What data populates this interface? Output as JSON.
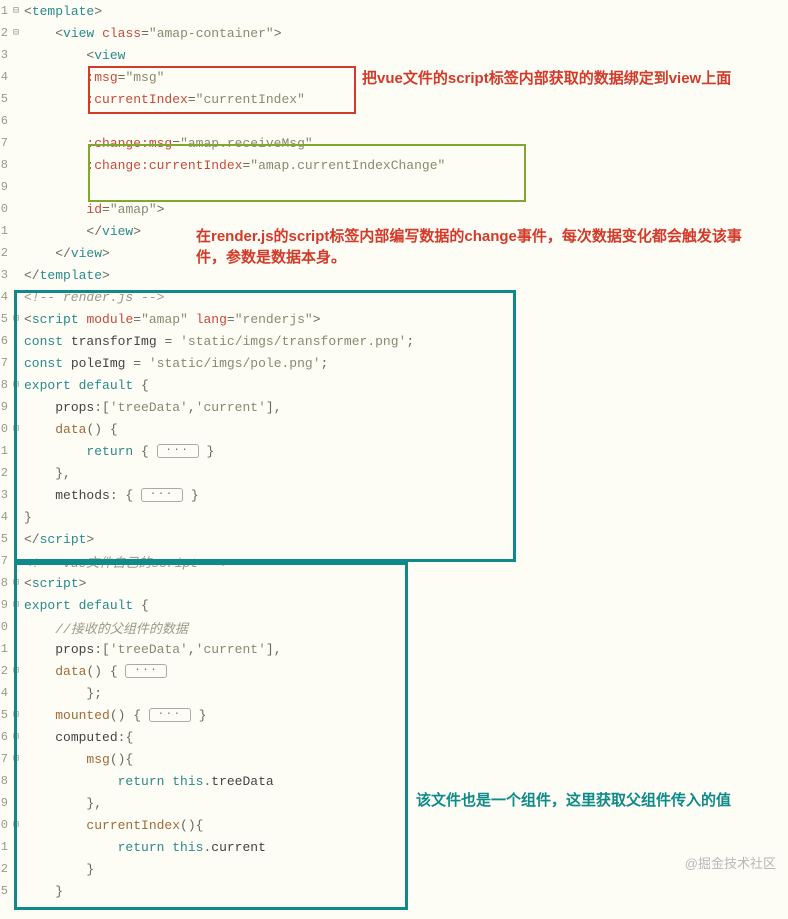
{
  "lines": [
    {
      "n": "1",
      "fold": "⊟",
      "html": "<span class='punct'>&lt;</span><span class='tag'>template</span><span class='punct'>&gt;</span>"
    },
    {
      "n": "2",
      "fold": "⊟",
      "html": "    <span class='punct'>&lt;</span><span class='tag'>view</span> <span class='attr'>class</span><span class='punct'>=</span><span class='str'>\"amap-container\"</span><span class='punct'>&gt;</span>"
    },
    {
      "n": "3",
      "fold": "",
      "html": "        <span class='punct'>&lt;</span><span class='tag'>view</span>"
    },
    {
      "n": "4",
      "fold": "",
      "html": "        <span class='attr'>:msg</span><span class='punct'>=</span><span class='str'>\"msg\"</span>"
    },
    {
      "n": "5",
      "fold": "",
      "html": "        <span class='attr'>:currentIndex</span><span class='punct'>=</span><span class='str'>\"currentIndex\"</span>"
    },
    {
      "n": "6",
      "fold": "",
      "html": ""
    },
    {
      "n": "7",
      "fold": "",
      "html": "        <span class='attr'>:change:msg</span><span class='punct'>=</span><span class='str'>\"amap.receiveMsg\"</span>"
    },
    {
      "n": "8",
      "fold": "",
      "html": "        <span class='attr'>:change:currentIndex</span><span class='punct'>=</span><span class='str'>\"amap.currentIndexChange\"</span>"
    },
    {
      "n": "9",
      "fold": "",
      "html": ""
    },
    {
      "n": "0",
      "fold": "",
      "html": "        <span class='attr'>id</span><span class='punct'>=</span><span class='str'>\"amap\"</span><span class='punct'>&gt;</span>"
    },
    {
      "n": "1",
      "fold": "",
      "html": "        <span class='punct'>&lt;/</span><span class='tag'>view</span><span class='punct'>&gt;</span>"
    },
    {
      "n": "2",
      "fold": "",
      "html": "    <span class='punct'>&lt;/</span><span class='tag'>view</span><span class='punct'>&gt;</span>"
    },
    {
      "n": "3",
      "fold": "",
      "html": "<span class='punct'>&lt;/</span><span class='tag'>template</span><span class='punct'>&gt;</span>"
    },
    {
      "n": "4",
      "fold": "",
      "html": "<span class='comment'>&lt;!-- render.js --&gt;</span>"
    },
    {
      "n": "5",
      "fold": "⊟",
      "html": "<span class='punct'>&lt;</span><span class='tag'>script</span> <span class='attr'>module</span><span class='punct'>=</span><span class='str'>\"amap\"</span> <span class='attr'>lang</span><span class='punct'>=</span><span class='str'>\"renderjs\"</span><span class='punct'>&gt;</span>"
    },
    {
      "n": "6",
      "fold": "",
      "html": "<span class='kw'>const</span> <span class='ident'>transforImg</span> <span class='punct'>=</span> <span class='str'>'static/imgs/transformer.png'</span><span class='punct'>;</span>"
    },
    {
      "n": "7",
      "fold": "",
      "html": "<span class='kw'>const</span> <span class='ident'>poleImg</span> <span class='punct'>=</span> <span class='str'>'static/imgs/pole.png'</span><span class='punct'>;</span>"
    },
    {
      "n": "8",
      "fold": "⊟",
      "html": "<span class='kw'>export</span> <span class='kw'>default</span> <span class='punct'>{</span>"
    },
    {
      "n": "9",
      "fold": "",
      "html": "    <span class='ident'>props</span><span class='punct'>:[</span><span class='str'>'treeData'</span><span class='punct'>,</span><span class='str'>'current'</span><span class='punct'>],</span>"
    },
    {
      "n": "0",
      "fold": "⊟",
      "html": "    <span class='kw2'>data</span><span class='punct'>() {</span>"
    },
    {
      "n": "1",
      "fold": "",
      "html": "        <span class='kw'>return</span> <span class='punct'>{</span> <span class='foldbox'>···</span> <span class='punct'>}</span>"
    },
    {
      "n": "2",
      "fold": "",
      "html": "    <span class='punct'>},</span>"
    },
    {
      "n": "3",
      "fold": "",
      "html": "    <span class='ident'>methods</span><span class='punct'>: {</span> <span class='foldbox'>···</span> <span class='punct'>}</span>"
    },
    {
      "n": "4",
      "fold": "",
      "html": "<span class='punct'>}</span>"
    },
    {
      "n": "5",
      "fold": "",
      "html": "<span class='punct'>&lt;/</span><span class='tag'>script</span><span class='punct'>&gt;</span>"
    },
    {
      "n": "7",
      "fold": "",
      "html": "<span class='comment'>&lt;!-- vue文件自己的script --&gt;</span>"
    },
    {
      "n": "8",
      "fold": "⊟",
      "html": "<span class='punct'>&lt;</span><span class='tag'>script</span><span class='punct'>&gt;</span>"
    },
    {
      "n": "9",
      "fold": "⊟",
      "html": "<span class='kw'>export</span> <span class='kw'>default</span> <span class='punct'>{</span>"
    },
    {
      "n": "0",
      "fold": "",
      "html": "    <span class='comment'>//接收的父组件的数据</span>"
    },
    {
      "n": "1",
      "fold": "",
      "html": "    <span class='ident'>props</span><span class='punct'>:[</span><span class='str'>'treeData'</span><span class='punct'>,</span><span class='str'>'current'</span><span class='punct'>],</span>"
    },
    {
      "n": "2",
      "fold": "⊟",
      "html": "    <span class='kw2'>data</span><span class='punct'>() {</span> <span class='foldbox'>···</span>"
    },
    {
      "n": "4",
      "fold": "",
      "html": "        <span class='punct'>};</span>"
    },
    {
      "n": "5",
      "fold": "⊟",
      "html": "    <span class='kw2'>mounted</span><span class='punct'>() {</span> <span class='foldbox'>···</span> <span class='punct'>}</span>"
    },
    {
      "n": "6",
      "fold": "⊟",
      "html": "    <span class='ident'>computed</span><span class='punct'>:{</span>"
    },
    {
      "n": "7",
      "fold": "⊟",
      "html": "        <span class='kw2'>msg</span><span class='punct'>(){</span>"
    },
    {
      "n": "8",
      "fold": "",
      "html": "            <span class='kw'>return</span> <span class='this'>this</span><span class='punct'>.</span><span class='ident'>treeData</span>"
    },
    {
      "n": "9",
      "fold": "",
      "html": "        <span class='punct'>},</span>"
    },
    {
      "n": "0",
      "fold": "⊟",
      "html": "        <span class='kw2'>currentIndex</span><span class='punct'>(){</span>"
    },
    {
      "n": "1",
      "fold": "",
      "html": "            <span class='kw'>return</span> <span class='this'>this</span><span class='punct'>.</span><span class='ident'>current</span>"
    },
    {
      "n": "2",
      "fold": "",
      "html": "        <span class='punct'>}</span>"
    },
    {
      "n": "5",
      "fold": "",
      "html": "    <span class='punct'>}</span>"
    }
  ],
  "annotations": {
    "red_text": "把vue文件的script标签内部获取的数据绑定到view上面",
    "red2_text": "在render.js的script标签内部编写数据的change事件，每次数据变化都会触发该事件，参数是数据本身。",
    "teal_text": "该文件也是一个组件，这里获取父组件传入的值"
  },
  "watermark": "@掘金技术社区"
}
